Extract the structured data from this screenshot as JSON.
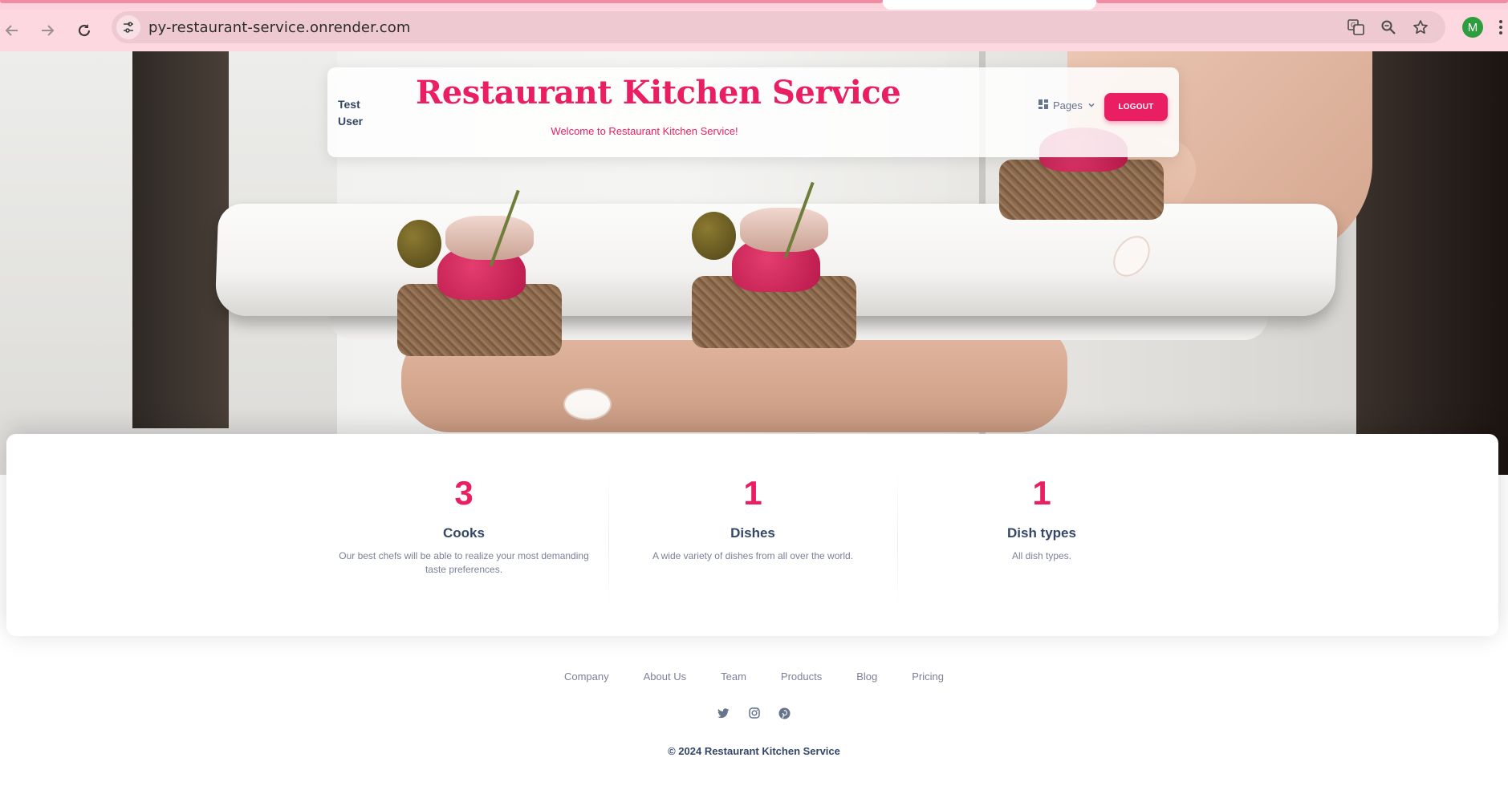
{
  "browser": {
    "url": "py-restaurant-service.onrender.com",
    "profile_initial": "M",
    "icons": [
      "back-arrow-icon",
      "forward-arrow-icon",
      "reload-icon",
      "site-info-icon",
      "translate-icon",
      "zoom-icon",
      "bookmark-star-icon",
      "menu-dots-icon"
    ]
  },
  "header": {
    "user_name": "Test User",
    "brand": "Restaurant Kitchen Service",
    "welcome": "Welcome to Restaurant Kitchen Service!",
    "pages_label": "Pages",
    "logout_label": "LOGOUT"
  },
  "stats": [
    {
      "count": "3",
      "title": "Cooks",
      "description": "Our best chefs will be able to realize your most demanding taste preferences."
    },
    {
      "count": "1",
      "title": "Dishes",
      "description": "A wide variety of dishes from all over the world."
    },
    {
      "count": "1",
      "title": "Dish types",
      "description": "All dish types."
    }
  ],
  "footer": {
    "links": [
      "Company",
      "About Us",
      "Team",
      "Products",
      "Blog",
      "Pricing"
    ],
    "socials": [
      "twitter-icon",
      "instagram-icon",
      "pinterest-icon"
    ],
    "copyright": "© 2024 Restaurant Kitchen Service"
  },
  "colors": {
    "accent": "#e91e63",
    "heading": "#344767",
    "muted": "#7b809a",
    "browser_chrome": "#fdd8e0"
  }
}
